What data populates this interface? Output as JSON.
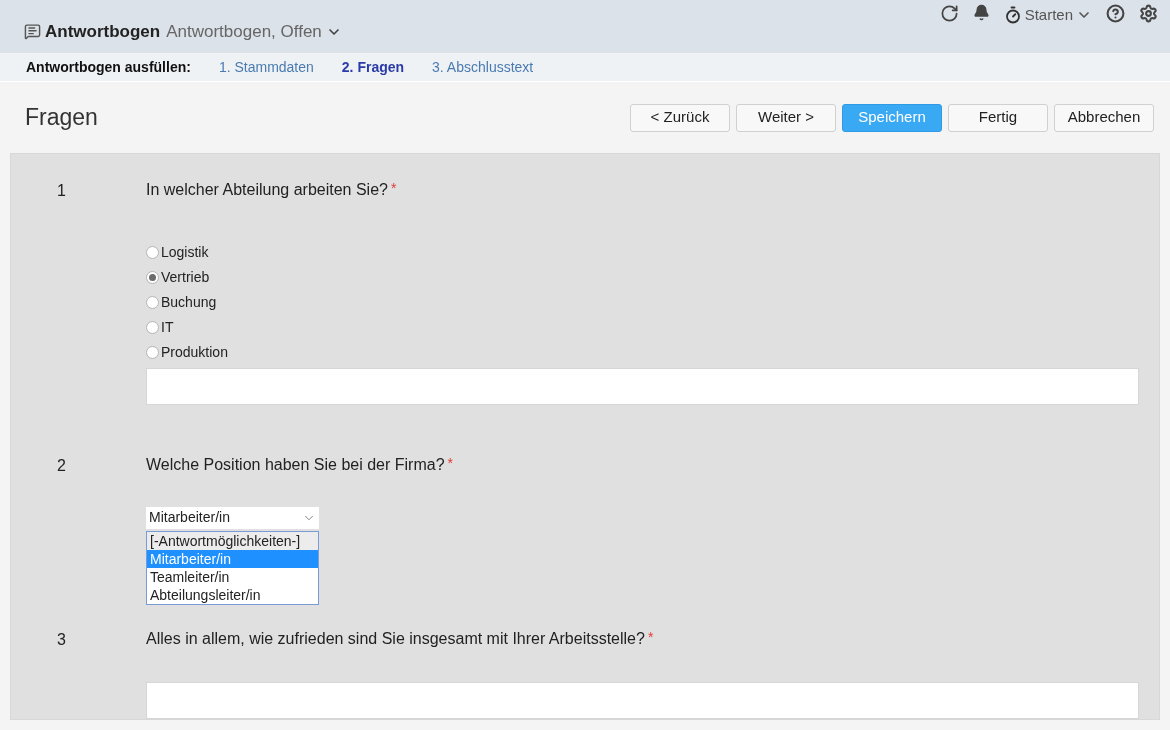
{
  "header": {
    "title": "Antwortbogen",
    "subtitle": "Antwortbogen, Offen",
    "timer_label": "Starten"
  },
  "steps": {
    "label": "Antwortbogen ausfüllen:",
    "items": [
      {
        "label": "1. Stammdaten",
        "selected": false
      },
      {
        "label": "2. Fragen",
        "selected": true
      },
      {
        "label": "3. Abschlusstext",
        "selected": false
      }
    ]
  },
  "page_title": "Fragen",
  "buttons": [
    {
      "label": "< Zurück",
      "primary": false
    },
    {
      "label": "Weiter >",
      "primary": false
    },
    {
      "label": "Speichern",
      "primary": true
    },
    {
      "label": "Fertig",
      "primary": false
    },
    {
      "label": "Abbrechen",
      "primary": false
    }
  ],
  "questions": [
    {
      "number": "1",
      "text": "In welcher Abteilung arbeiten Sie?",
      "required_mark": "*",
      "kind": "radio",
      "options": [
        {
          "label": "Logistik",
          "selected": false
        },
        {
          "label": "Vertrieb",
          "selected": true
        },
        {
          "label": "Buchung",
          "selected": false
        },
        {
          "label": "IT",
          "selected": false
        },
        {
          "label": "Produktion",
          "selected": false
        }
      ],
      "comment_field": true
    },
    {
      "number": "2",
      "text": "Welche Position haben Sie bei der Firma?",
      "required_mark": "*",
      "kind": "select",
      "value": "Mitarbeiter/in",
      "options": [
        {
          "label": "[-Antwortmöglichkeiten-]",
          "selected": false,
          "kind": "placeholder"
        },
        {
          "label": "Mitarbeiter/in",
          "selected": true,
          "kind": "option"
        },
        {
          "label": "Teamleiter/in",
          "selected": false,
          "kind": "option"
        },
        {
          "label": "Abteilungsleiter/in",
          "selected": false,
          "kind": "option"
        }
      ]
    },
    {
      "number": "3",
      "text": "Alles in allem, wie zufrieden sind Sie insgesamt mit Ihrer Arbeitsstelle?",
      "required_mark": "*",
      "kind": "text"
    }
  ]
}
